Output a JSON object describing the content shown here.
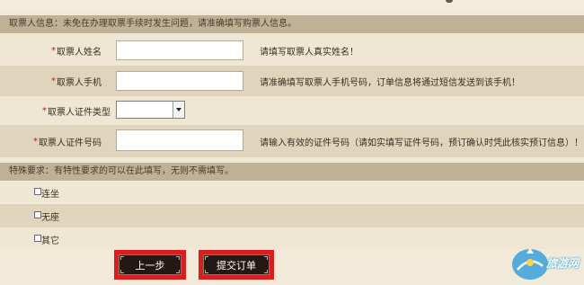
{
  "section_ticket": {
    "header": "取票人信息：未免在办理取票手续时发生问题，请准确填写购票人信息。"
  },
  "fields": [
    {
      "required_mark": "*",
      "label": "取票人姓名",
      "value": "",
      "hint": "请填写取票人真实姓名！"
    },
    {
      "required_mark": "*",
      "label": "取票人手机",
      "value": "",
      "hint": "请准确填写取票人手机号码，订单信息将通过短信发送到该手机！"
    },
    {
      "required_mark": "*",
      "label": "取票人证件类型",
      "selected": ""
    },
    {
      "required_mark": "*",
      "label": "取票人证件号码",
      "value": "",
      "hint": "请输入有效的证件号码（请如实填写证件号码，预订确认时凭此核实预订信息）！"
    }
  ],
  "section_special": {
    "header": "特殊要求：有特性要求的可以在此填写，无则不需填写。",
    "options": [
      "连坐",
      "无座",
      "其它"
    ]
  },
  "buttons": {
    "prev": "上一步",
    "submit": "提交订单"
  },
  "watermark": {
    "text": "旅游网"
  },
  "colors": {
    "header_bg": "#bfb195",
    "row_dark": "#e0d5bc",
    "row_light": "#efe7d3",
    "required": "#c8121c",
    "button_bg": "#241814",
    "button_border": "#d81e1e"
  }
}
